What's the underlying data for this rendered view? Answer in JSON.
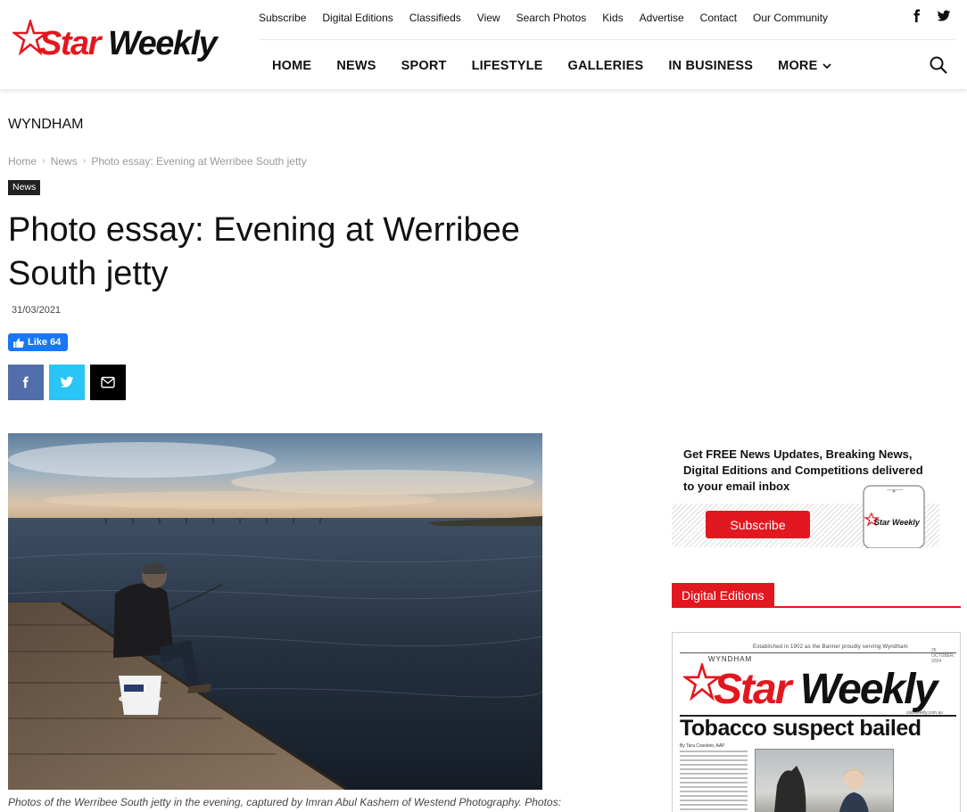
{
  "brand": {
    "name_red": "Star",
    "name_black": "Weekly",
    "color_red": "#e3171f"
  },
  "top_menu": [
    "Subscribe",
    "Digital Editions",
    "Classifieds",
    "View",
    "Search Photos",
    "Kids",
    "Advertise",
    "Contact",
    "Our Community"
  ],
  "social": {
    "facebook_icon": "facebook-icon",
    "twitter_icon": "twitter-icon"
  },
  "main_menu": [
    "HOME",
    "NEWS",
    "SPORT",
    "LIFESTYLE",
    "GALLERIES",
    "IN BUSINESS",
    "MORE"
  ],
  "search_icon": "search-icon",
  "section": "WYNDHAM",
  "breadcrumb": [
    "Home",
    "News",
    "Photo essay: Evening at Werribee South jetty"
  ],
  "category": "News",
  "article": {
    "title": "Photo essay: Evening at Werribee South jetty",
    "date": "31/03/2021",
    "like_label": "Like 64",
    "caption": "Photos of the Werribee South jetty in the evening, captured by Imran Abul Kashem of Westend Photography. Photos:"
  },
  "share": {
    "facebook": "facebook-icon",
    "twitter": "twitter-icon",
    "email": "mail-icon"
  },
  "promo": {
    "text": "Get FREE News Updates, Breaking News, Digital Editions and Competitions delivered to your email inbox",
    "button": "Subscribe",
    "phone_logo": "Star Weekly"
  },
  "digital_editions": {
    "label": "Digital Editions",
    "paper": {
      "top_line": "Established in 1902 as the Banner proudly serving Wyndham",
      "date_small": "26 OCTOBER, 2024",
      "area": "WYNDHAM",
      "logo_red": "Star",
      "logo_black": "Weekly",
      "url": "starweekly.com.au",
      "headline": "Tobacco suspect bailed",
      "byline": "By Tara Cosoleto, AAP"
    }
  }
}
